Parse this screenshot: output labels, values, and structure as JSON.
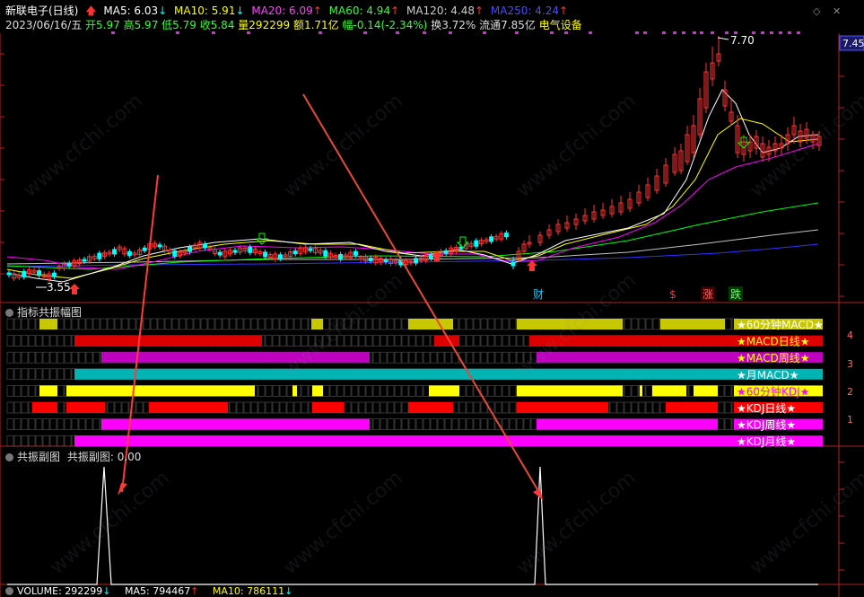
{
  "header": {
    "stock_name": "新联电子(日线)",
    "ma5": "MA5: 6.03",
    "ma10": "MA10: 5.91",
    "ma20": "MA20: 6.09",
    "ma60": "MA60: 4.94",
    "ma120": "MA120: 4.48",
    "ma250": "MA250: 4.24",
    "date": "2023/06/16/五",
    "open": "开5.97",
    "high": "高5.97",
    "low": "低5.79",
    "close": "收5.84",
    "volume": "量292299",
    "amount": "额1.71亿",
    "change": "幅-0.14(-2.34%)",
    "turnover": "换3.72%",
    "float_cap": "流通7.85亿",
    "sector": "电气设备"
  },
  "colors": {
    "up": "#ff3232",
    "down": "#00ffff",
    "ma5": "#ffffff",
    "ma10": "#ffff00",
    "ma20": "#ff00ff",
    "ma60": "#00ff00",
    "ma120": "#c0c0c0",
    "ma250": "#3232ff",
    "axis_red": "#b22222"
  },
  "main_chart": {
    "price_high_label": "7.70",
    "price_low_label": "3.55",
    "current_price_tag": "7.45",
    "markers": [
      "财",
      "$",
      "涨",
      "跌"
    ]
  },
  "resonance_panel": {
    "title": "指标共振幅图",
    "rows": [
      {
        "label": "★60分钟MACD★",
        "color": "#c8c800",
        "label_color": "#ffffff"
      },
      {
        "label": "★MACD日线★",
        "color": "#dd0000",
        "label_color": "#ffff00"
      },
      {
        "label": "★MACD周线★",
        "color": "#c000c0",
        "label_color": "#ffff00"
      },
      {
        "label": "★月MACD★",
        "color": "#00b4b4",
        "label_color": "#ffffff"
      },
      {
        "label": "★60分钟KDJ★",
        "color": "#ffff00",
        "label_color": "#ff00ff"
      },
      {
        "label": "★KDJ日线★",
        "color": "#ff0000",
        "label_color": "#ffffff"
      },
      {
        "label": "★KDJ周线★",
        "color": "#ff00ff",
        "label_color": "#ffffff"
      },
      {
        "label": "★KDJ月线★",
        "color": "#ff00ff",
        "label_color": "#ffffff"
      }
    ],
    "right_axis": [
      "4",
      "3",
      "2",
      "1"
    ]
  },
  "sub_panel": {
    "title": "共振副图",
    "value_label": "共振副图: 0.00"
  },
  "volume_panel": {
    "volume": "VOLUME: 292299",
    "ma5": "MA5: 794467",
    "ma10": "MA10: 786111"
  },
  "controls": {
    "collapse": "◇",
    "close": "✕"
  },
  "watermark": "www.cfchi.com"
}
